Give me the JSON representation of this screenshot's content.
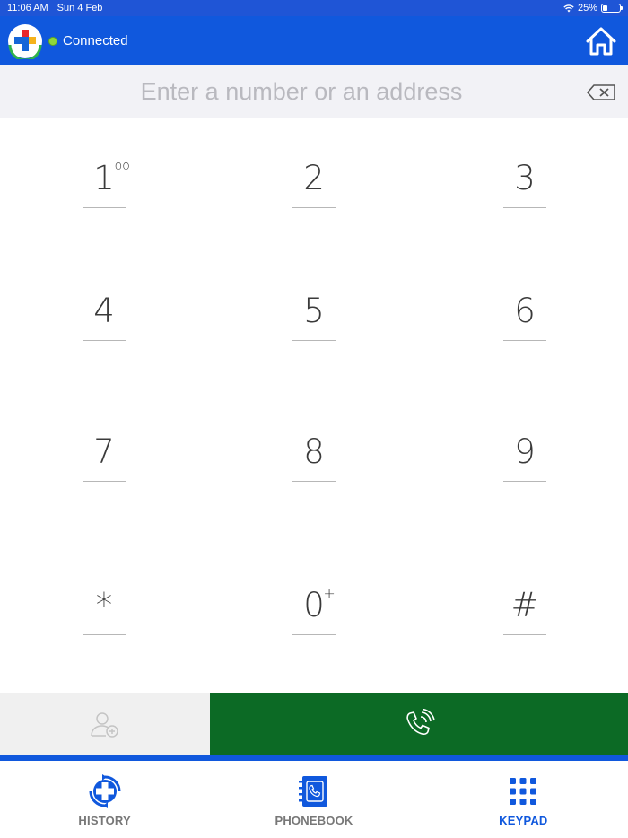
{
  "status_bar": {
    "time": "11:06 AM",
    "date": "Sun 4 Feb",
    "battery_percent": "25%",
    "battery_level": 0.25
  },
  "header": {
    "connection_status": "Connected",
    "logo_icon": "cross-logo-icon",
    "home_icon": "home-icon"
  },
  "input": {
    "value": "",
    "placeholder": "Enter a number or an address",
    "backspace_icon": "backspace-icon"
  },
  "keypad": {
    "keys": [
      {
        "label": "1",
        "sup": "oo"
      },
      {
        "label": "2",
        "sup": ""
      },
      {
        "label": "3",
        "sup": ""
      },
      {
        "label": "4",
        "sup": ""
      },
      {
        "label": "5",
        "sup": ""
      },
      {
        "label": "6",
        "sup": ""
      },
      {
        "label": "7",
        "sup": ""
      },
      {
        "label": "8",
        "sup": ""
      },
      {
        "label": "9",
        "sup": ""
      },
      {
        "label": "*",
        "sup": ""
      },
      {
        "label": "0",
        "sup": "+"
      },
      {
        "label": "#",
        "sup": ""
      }
    ]
  },
  "actions": {
    "add_contact_icon": "add-contact-icon",
    "call_icon": "phone-call-icon"
  },
  "tabs": [
    {
      "label": "HISTORY",
      "icon": "history-icon",
      "active": false
    },
    {
      "label": "PHONEBOOK",
      "icon": "phonebook-icon",
      "active": false
    },
    {
      "label": "KEYPAD",
      "icon": "keypad-icon",
      "active": true
    }
  ],
  "colors": {
    "brand_blue": "#1058dd",
    "call_green": "#0c6a25",
    "connected_dot": "#8ed83a",
    "inactive_tab": "#777777"
  }
}
